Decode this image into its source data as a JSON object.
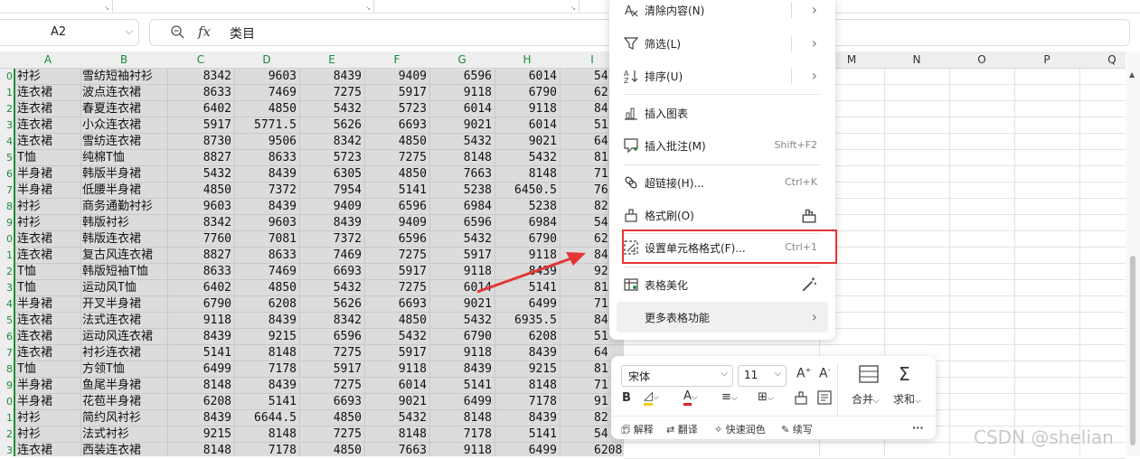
{
  "name_box": {
    "value": "A2"
  },
  "formula_bar": {
    "fx": "fx",
    "content": "类目"
  },
  "column_headers": [
    "A",
    "B",
    "C",
    "D",
    "E",
    "F",
    "G",
    "H",
    "I",
    "M",
    "N",
    "O",
    "P",
    "Q"
  ],
  "row_numbers": [
    "0",
    "1",
    "2",
    "3",
    "4",
    "5",
    "6",
    "7",
    "8",
    "9",
    "0",
    "1",
    "2",
    "3",
    "4",
    "5",
    "6",
    "7",
    "8",
    "9",
    "0",
    "1",
    "2",
    "3"
  ],
  "rows": [
    [
      "衬衫",
      "雪纺短袖衬衫",
      "8342",
      "9603",
      "8439",
      "9409",
      "6596",
      "6014",
      "54"
    ],
    [
      "连衣裙",
      "波点连衣裙",
      "8633",
      "7469",
      "7275",
      "5917",
      "9118",
      "6790",
      "62"
    ],
    [
      "连衣裙",
      "春夏连衣裙",
      "6402",
      "4850",
      "5432",
      "5723",
      "6014",
      "9118",
      "84"
    ],
    [
      "连衣裙",
      "小众连衣裙",
      "5917",
      "5771.5",
      "5626",
      "6693",
      "9021",
      "6014",
      "51"
    ],
    [
      "连衣裙",
      "雪纺连衣裙",
      "8730",
      "9506",
      "8342",
      "4850",
      "5432",
      "9021",
      "64"
    ],
    [
      "T恤",
      "纯棉T恤",
      "8827",
      "8633",
      "5723",
      "7275",
      "8148",
      "5432",
      "81"
    ],
    [
      "半身裙",
      "韩版半身裙",
      "5432",
      "8439",
      "6305",
      "4850",
      "7663",
      "8148",
      "71"
    ],
    [
      "半身裙",
      "低腰半身裙",
      "4850",
      "7372",
      "7954",
      "5141",
      "5238",
      "6450.5",
      "76"
    ],
    [
      "衬衫",
      "商务通勤衬衫",
      "9603",
      "8439",
      "9409",
      "6596",
      "6984",
      "5238",
      "82"
    ],
    [
      "衬衫",
      "韩版衬衫",
      "8342",
      "9603",
      "8439",
      "9409",
      "6596",
      "6984",
      "54"
    ],
    [
      "连衣裙",
      "韩版连衣裙",
      "7760",
      "7081",
      "7372",
      "6596",
      "5432",
      "6790",
      "62"
    ],
    [
      "连衣裙",
      "复古风连衣裙",
      "8827",
      "8633",
      "7469",
      "7275",
      "5917",
      "9118",
      "84"
    ],
    [
      "T恤",
      "韩版短袖T恤",
      "8633",
      "7469",
      "6693",
      "5917",
      "9118",
      "8439",
      "92"
    ],
    [
      "T恤",
      "运动风T恤",
      "6402",
      "4850",
      "5432",
      "7275",
      "6014",
      "5141",
      "81"
    ],
    [
      "半身裙",
      "开叉半身裙",
      "6790",
      "6208",
      "5626",
      "6693",
      "9021",
      "6499",
      "71"
    ],
    [
      "连衣裙",
      "法式连衣裙",
      "9118",
      "8439",
      "8342",
      "4850",
      "5432",
      "6935.5",
      "84"
    ],
    [
      "连衣裙",
      "运动风连衣裙",
      "8439",
      "9215",
      "6596",
      "5432",
      "6790",
      "6208",
      "51"
    ],
    [
      "连衣裙",
      "衬衫连衣裙",
      "5141",
      "8148",
      "7275",
      "5917",
      "9118",
      "8439",
      "64"
    ],
    [
      "T恤",
      "方领T恤",
      "6499",
      "7178",
      "5917",
      "9118",
      "8439",
      "9215",
      "81"
    ],
    [
      "半身裙",
      "鱼尾半身裙",
      "8148",
      "8439",
      "7275",
      "6014",
      "5141",
      "8148",
      "71"
    ],
    [
      "半身裙",
      "花苞半身裙",
      "6208",
      "5141",
      "6693",
      "9021",
      "6499",
      "7178",
      "91"
    ],
    [
      "衬衫",
      "简约风衬衫",
      "8439",
      "6644.5",
      "4850",
      "5432",
      "8148",
      "8439",
      "82"
    ],
    [
      "衬衫",
      "法式衬衫",
      "9215",
      "8148",
      "7275",
      "8148",
      "7178",
      "5141",
      "54"
    ],
    [
      "连衣裙",
      "西装连衣裙",
      "8148",
      "7178",
      "4850",
      "7663",
      "9118",
      "6499",
      "6208"
    ]
  ],
  "context_menu": {
    "items": [
      {
        "label": "清除内容(N)",
        "shortcut": "",
        "icon": "clear-content-icon"
      },
      {
        "label": "筛选(L)",
        "shortcut": "",
        "icon": "filter-icon"
      },
      {
        "label": "排序(U)",
        "shortcut": "",
        "icon": "sort-icon"
      },
      {
        "label": "插入图表",
        "shortcut": "",
        "icon": "chart-icon"
      },
      {
        "label": "插入批注(M)",
        "shortcut": "Shift+F2",
        "icon": "comment-icon"
      },
      {
        "label": "超链接(H)...",
        "shortcut": "Ctrl+K",
        "icon": "link-icon"
      },
      {
        "label": "格式刷(O)",
        "shortcut": "",
        "icon": "format-painter-icon"
      },
      {
        "label": "设置单元格格式(F)...",
        "shortcut": "Ctrl+1",
        "icon": "format-cells-icon"
      },
      {
        "label": "表格美化",
        "shortcut": "",
        "icon": "table-beautify-icon"
      },
      {
        "label": "更多表格功能",
        "shortcut": "",
        "icon": ""
      }
    ]
  },
  "mini_toolbar": {
    "font": "宋体",
    "size": "11",
    "merge_label": "合并",
    "sum_label": "求和",
    "bottom": [
      "解释",
      "翻译",
      "快速润色",
      "续写"
    ],
    "more": "···"
  },
  "watermark": "CSDN @shelian",
  "colors": {
    "selection_green": "#1f8b3b",
    "highlight_red": "#e53535",
    "arrow_red": "#e53535"
  }
}
